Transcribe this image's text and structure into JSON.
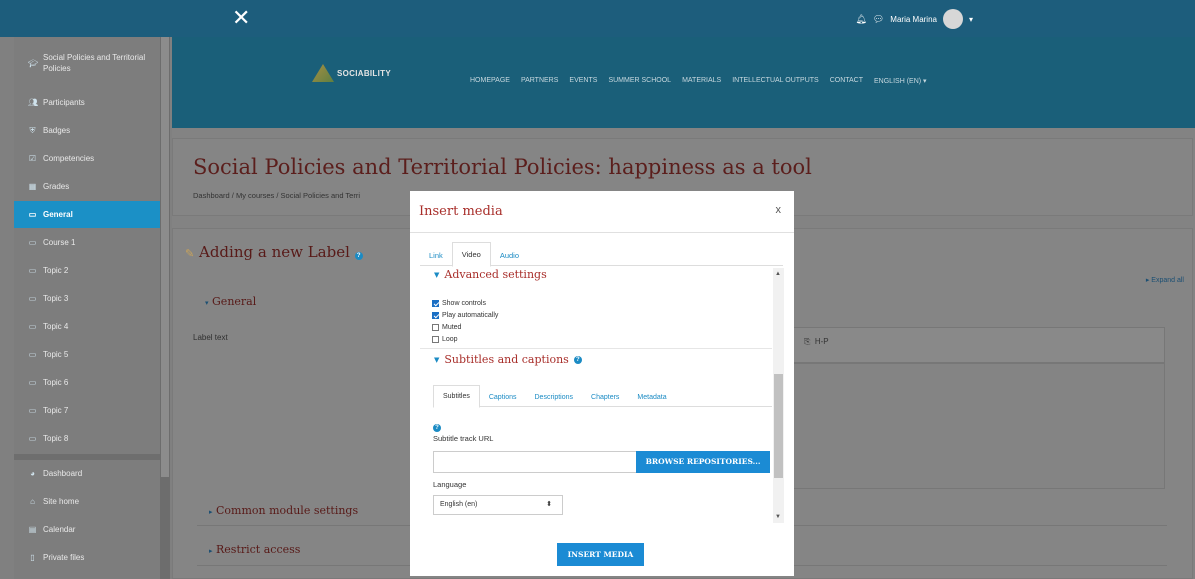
{
  "topbar": {
    "close_icon": "close-icon",
    "user_name": "Maria Marina",
    "notification_icon": "bell-icon",
    "messages_icon": "chat-icon",
    "user_menu_caret": "▾"
  },
  "drawer": {
    "items": [
      {
        "label": "Social Policies and Territorial Policies",
        "icon": "graduation-cap-icon"
      },
      {
        "label": "Participants",
        "icon": "users-icon"
      },
      {
        "label": "Badges",
        "icon": "shield-icon"
      },
      {
        "label": "Competencies",
        "icon": "check-square-icon"
      },
      {
        "label": "Grades",
        "icon": "table-icon"
      },
      {
        "label": "General",
        "icon": "folder-icon"
      },
      {
        "label": "Course 1",
        "icon": "folder-icon"
      },
      {
        "label": "Topic 2",
        "icon": "folder-icon"
      },
      {
        "label": "Topic 3",
        "icon": "folder-icon"
      },
      {
        "label": "Topic 4",
        "icon": "folder-icon"
      },
      {
        "label": "Topic 5",
        "icon": "folder-icon"
      },
      {
        "label": "Topic 6",
        "icon": "folder-icon"
      },
      {
        "label": "Topic 7",
        "icon": "folder-icon"
      },
      {
        "label": "Topic 8",
        "icon": "folder-icon"
      },
      {
        "label": "Dashboard",
        "icon": "dashboard-icon"
      },
      {
        "label": "Site home",
        "icon": "home-icon"
      },
      {
        "label": "Calendar",
        "icon": "calendar-icon"
      },
      {
        "label": "Private files",
        "icon": "file-icon"
      }
    ]
  },
  "hero": {
    "logo_text": "SOCIABILITY",
    "nav": [
      "HOMEPAGE",
      "PARTNERS",
      "EVENTS",
      "SUMMER SCHOOL",
      "MATERIALS",
      "INTELLECTUAL OUTPUTS",
      "CONTACT",
      "ENGLISH (EN) ▾"
    ]
  },
  "page": {
    "title": "Social Policies and Territorial Policies: happiness as a tool",
    "breadcrumb": "Dashboard  /  My courses  /  Social Policies and Terri",
    "heading": "Adding a new Label",
    "expand_all": "Expand all",
    "general": "General",
    "label_text": "Label text",
    "common_module_settings": "Common module settings",
    "restrict_access": "Restrict access"
  },
  "modal": {
    "title": "Insert media",
    "close": "x",
    "tabs": [
      "Link",
      "Video",
      "Audio"
    ],
    "active_tab": "Video",
    "advanced_settings": "Advanced settings",
    "options": [
      {
        "label": "Show controls",
        "checked": true
      },
      {
        "label": "Play automatically",
        "checked": true
      },
      {
        "label": "Muted",
        "checked": false
      },
      {
        "label": "Loop",
        "checked": false
      }
    ],
    "subtitles_heading": "Subtitles and captions",
    "subtabs": [
      "Subtitles",
      "Captions",
      "Descriptions",
      "Chapters",
      "Metadata"
    ],
    "active_subtab": "Subtitles",
    "track_url_label": "Subtitle track URL",
    "browse_button": "BROWSE REPOSITORIES...",
    "language_label": "Language",
    "language_value": "English (en)",
    "insert_button": "INSERT MEDIA"
  }
}
